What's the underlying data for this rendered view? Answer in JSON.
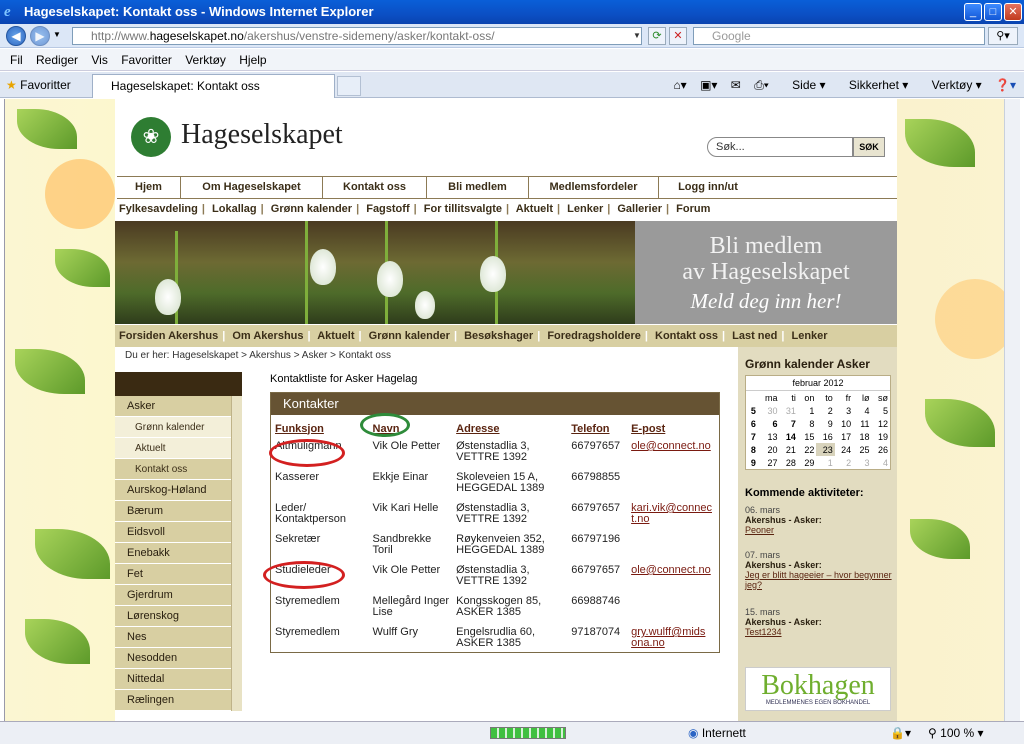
{
  "window": {
    "title": "Hageselskapet: Kontakt oss - Windows Internet Explorer"
  },
  "address": {
    "url_prefix": "http://www.",
    "url_domain": "hageselskapet.no",
    "url_path": "/akershus/venstre-sidemeny/asker/kontakt-oss/",
    "search_placeholder": "Google"
  },
  "menu": [
    "Fil",
    "Rediger",
    "Vis",
    "Favoritter",
    "Verktøy",
    "Hjelp"
  ],
  "tabs": {
    "favorites": "Favoritter",
    "active_tab": "Hageselskapet: Kontakt oss"
  },
  "commands": [
    "Side",
    "Sikkerhet",
    "Verktøy"
  ],
  "site": {
    "logo": "Hageselskapet",
    "search_placeholder": "Søk...",
    "search_button": "SØK",
    "main_nav": [
      "Hjem",
      "Om Hageselskapet",
      "Kontakt oss",
      "Bli medlem",
      "Medlemsfordeler",
      "Logg inn/ut"
    ],
    "sub_nav": [
      "Fylkesavdeling",
      "Lokallag",
      "Grønn kalender",
      "Fagstoff",
      "For tillitsvalgte",
      "Aktuelt",
      "Lenker",
      "Gallerier",
      "Forum"
    ],
    "banner": {
      "line1": "Bli medlem",
      "line2": "av Hageselskapet",
      "line3": "Meld deg inn her!"
    },
    "region_nav": [
      "Forsiden Akershus",
      "Om Akershus",
      "Aktuelt",
      "Grønn kalender",
      "Besøkshager",
      "Foredragsholdere",
      "Kontakt oss",
      "Last ned",
      "Lenker"
    ],
    "breadcrumb": "Du er her: Hageselskapet > Akershus > Asker > Kontakt oss",
    "left_menu": [
      {
        "label": "Asker",
        "sub": false
      },
      {
        "label": "Grønn kalender",
        "sub": true
      },
      {
        "label": "Aktuelt",
        "sub": true
      },
      {
        "label": "Kontakt oss",
        "sub": true
      },
      {
        "label": "Aurskog-Høland",
        "sub": false
      },
      {
        "label": "Bærum",
        "sub": false
      },
      {
        "label": "Eidsvoll",
        "sub": false
      },
      {
        "label": "Enebakk",
        "sub": false
      },
      {
        "label": "Fet",
        "sub": false
      },
      {
        "label": "Gjerdrum",
        "sub": false
      },
      {
        "label": "Lørenskog",
        "sub": false
      },
      {
        "label": "Nes",
        "sub": false
      },
      {
        "label": "Nesodden",
        "sub": false
      },
      {
        "label": "Nittedal",
        "sub": false
      },
      {
        "label": "Rælingen",
        "sub": false
      }
    ],
    "contact": {
      "title": "Kontaktliste for Asker Hagelag",
      "box_title": "Kontakter",
      "headers": [
        "Funksjon",
        "Navn",
        "Adresse",
        "Telefon",
        "E-post"
      ],
      "rows": [
        {
          "funksjon": "Altmuligmann",
          "navn": "Vik Ole Petter",
          "adresse1": "Østenstadlia 3,",
          "adresse2": "VETTRE 1392",
          "telefon": "66797657",
          "epost1": "ole@connect.no",
          "epost2": ""
        },
        {
          "funksjon": "Kasserer",
          "navn": "Ekkje Einar",
          "adresse1": "Skoleveien 15 A,",
          "adresse2": "HEGGEDAL 1389",
          "telefon": "66798855",
          "epost1": "",
          "epost2": ""
        },
        {
          "funksjon": "Leder/ Kontaktperson",
          "navn": "Vik Kari Helle",
          "adresse1": "Østenstadlia 3,",
          "adresse2": "VETTRE 1392",
          "telefon": "66797657",
          "epost1": "kari.vik@connec",
          "epost2": "t.no"
        },
        {
          "funksjon": "Sekretær",
          "navn": "Sandbrekke Toril",
          "adresse1": "Røykenveien 352,",
          "adresse2": "HEGGEDAL 1389",
          "telefon": "66797196",
          "epost1": "",
          "epost2": ""
        },
        {
          "funksjon": "Studieleder",
          "navn": "Vik Ole Petter",
          "adresse1": "Østenstadlia 3,",
          "adresse2": "VETTRE 1392",
          "telefon": "66797657",
          "epost1": "ole@connect.no",
          "epost2": ""
        },
        {
          "funksjon": "Styremedlem",
          "navn": "Mellegård Inger Lise",
          "adresse1": "Kongsskogen 85,",
          "adresse2": "ASKER 1385",
          "telefon": "66988746",
          "epost1": "",
          "epost2": ""
        },
        {
          "funksjon": "Styremedlem",
          "navn": "Wulff Gry",
          "adresse1": "Engelsrudlia 60,",
          "adresse2": "ASKER 1385",
          "telefon": "97187074",
          "epost1": "gry.wulff@mids",
          "epost2": "ona.no"
        }
      ]
    },
    "sidebar": {
      "calendar_title": "Grønn kalender Asker",
      "month": "februar 2012",
      "weekdays": [
        "ma",
        "ti",
        "on",
        "to",
        "fr",
        "lø",
        "sø"
      ],
      "weeks": [
        [
          "5",
          "30",
          "31",
          "1",
          "2",
          "3",
          "4",
          "5"
        ],
        [
          "6",
          "6",
          "7",
          "8",
          "9",
          "10",
          "11",
          "12"
        ],
        [
          "7",
          "13",
          "14",
          "15",
          "16",
          "17",
          "18",
          "19"
        ],
        [
          "8",
          "20",
          "21",
          "22",
          "23",
          "24",
          "25",
          "26"
        ],
        [
          "9",
          "27",
          "28",
          "29",
          "1",
          "2",
          "3",
          "4"
        ]
      ],
      "activities_title": "Kommende aktiviteter:",
      "activities": [
        {
          "date": "06. mars",
          "head": "Akershus - Asker:",
          "link": "Peoner"
        },
        {
          "date": "07. mars",
          "head": "Akershus - Asker:",
          "link": "Jeg er blitt hageeier – hvor begynner jeg?"
        },
        {
          "date": "15. mars",
          "head": "Akershus - Asker:",
          "link": "Test1234"
        }
      ],
      "ad_text": "Bokhagen",
      "ad_sub": "MEDLEMMENES EGEN BOKHANDEL"
    }
  },
  "status": {
    "zone": "Internett",
    "zoom": "100 %"
  }
}
